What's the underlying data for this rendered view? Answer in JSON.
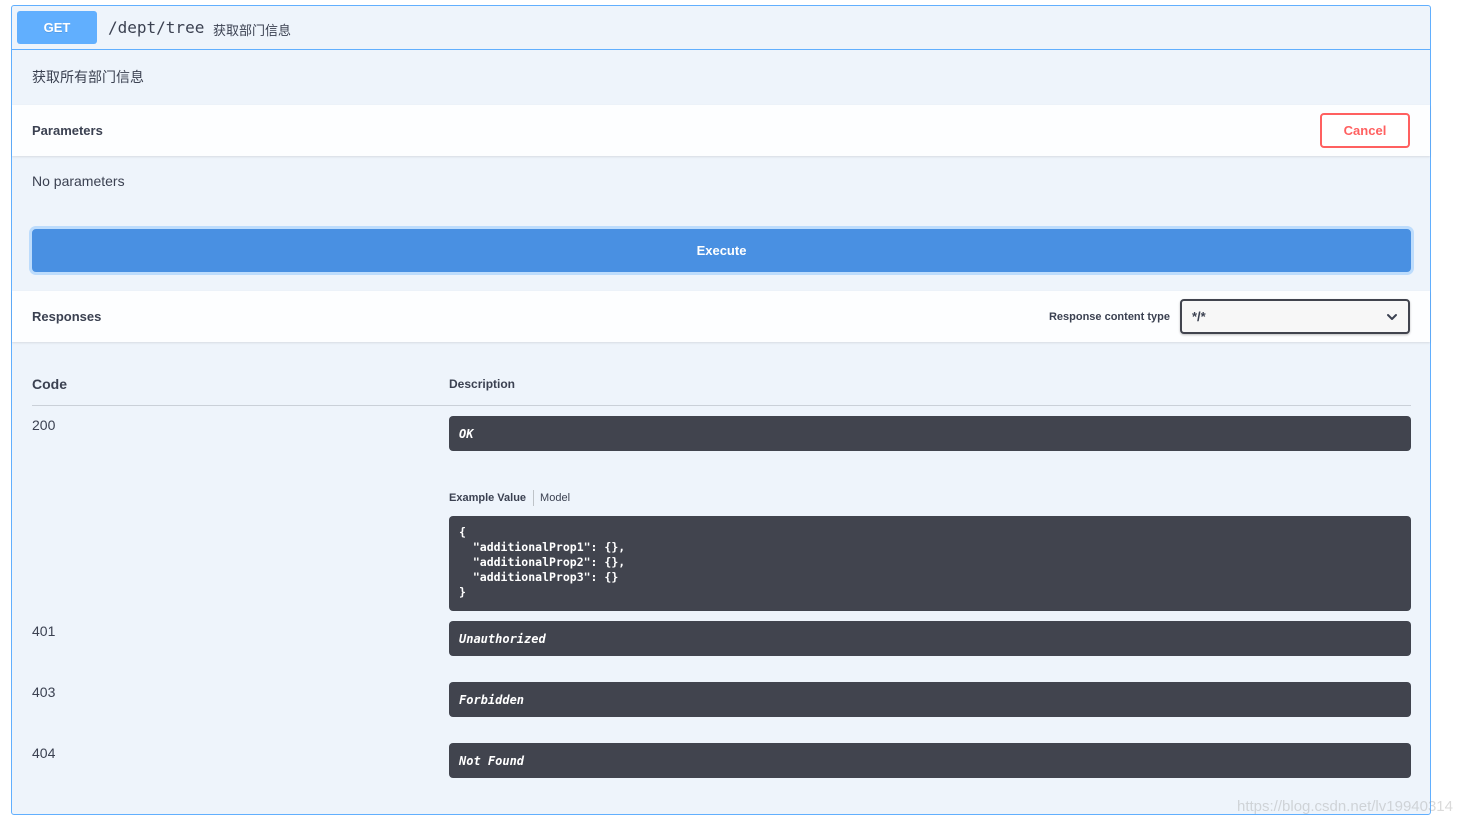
{
  "summary": {
    "method": "GET",
    "path": "/dept/tree",
    "path_description": "获取部门信息"
  },
  "description": "获取所有部门信息",
  "parameters": {
    "title": "Parameters",
    "cancel_label": "Cancel",
    "empty_text": "No parameters"
  },
  "execute_label": "Execute",
  "responses": {
    "title": "Responses",
    "content_type_label": "Response content type",
    "content_type_value": "*/*",
    "columns": {
      "code": "Code",
      "description": "Description"
    },
    "items": [
      {
        "code": "200",
        "description": "OK"
      },
      {
        "code": "401",
        "description": "Unauthorized"
      },
      {
        "code": "403",
        "description": "Forbidden"
      },
      {
        "code": "404",
        "description": "Not Found"
      }
    ],
    "tabs": {
      "example": "Example Value",
      "model": "Model"
    },
    "example_value": "{\n  \"additionalProp1\": {},\n  \"additionalProp2\": {},\n  \"additionalProp3\": {}\n}"
  },
  "watermark": "https://blog.csdn.net/lv19940314",
  "colors": {
    "method_get": "#61affe",
    "execute": "#4990e2",
    "cancel": "#ff6060",
    "dark_box": "#41444e",
    "block_bg": "#eef4fb"
  }
}
